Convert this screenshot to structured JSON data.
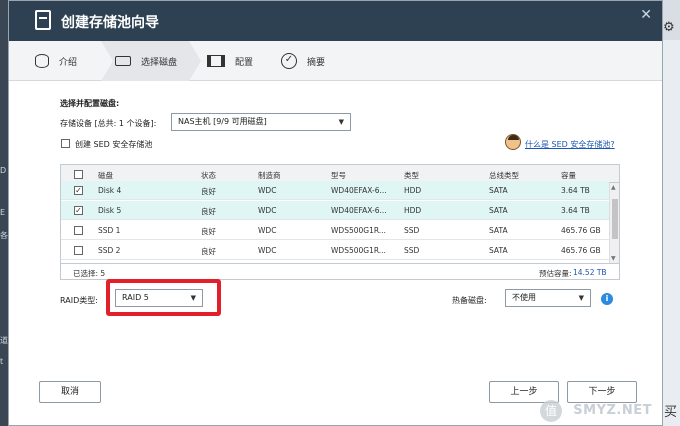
{
  "background": {
    "left_chars": [
      "D",
      "E",
      "各",
      "道",
      "t"
    ],
    "right_char": "买"
  },
  "window": {
    "title": "创建存储池向导",
    "close_glyph": "✕"
  },
  "steps": [
    {
      "label": "介绍",
      "icon": "database-icon"
    },
    {
      "label": "选择磁盘",
      "icon": "disk-icon"
    },
    {
      "label": "配置",
      "icon": "config-icon"
    },
    {
      "label": "摘要",
      "icon": "check-circle-icon"
    }
  ],
  "form": {
    "section_title": "选择并配置磁盘:",
    "storage_device_label": "存储设备 [总共: 1 个设备]:",
    "storage_device_value": "NAS主机 [9/9 可用磁盘]",
    "sed_checkbox_label": "创建 SED 安全存储池",
    "sed_link": "什么是 SED 安全存储池?"
  },
  "table": {
    "headers": [
      "磁盘",
      "状态",
      "制造商",
      "型号",
      "类型",
      "总线类型",
      "容量"
    ],
    "rows": [
      {
        "checked": true,
        "disk": "Disk 4",
        "status": "良好",
        "vendor": "WDC",
        "model": "WD40EFAX-6...",
        "type": "HDD",
        "bus": "SATA",
        "capacity": "3.64 TB"
      },
      {
        "checked": true,
        "disk": "Disk 5",
        "status": "良好",
        "vendor": "WDC",
        "model": "WD40EFAX-6...",
        "type": "HDD",
        "bus": "SATA",
        "capacity": "3.64 TB"
      },
      {
        "checked": false,
        "disk": "SSD 1",
        "status": "良好",
        "vendor": "WDC",
        "model": "WDS500G1R...",
        "type": "SSD",
        "bus": "SATA",
        "capacity": "465.76 GB"
      },
      {
        "checked": false,
        "disk": "SSD 2",
        "status": "良好",
        "vendor": "WDC",
        "model": "WDS500G1R...",
        "type": "SSD",
        "bus": "SATA",
        "capacity": "465.76 GB"
      }
    ],
    "selected_count_label": "已选择: 5",
    "estimated_capacity_label": "预估容量:",
    "estimated_capacity_value": "14.52 TB"
  },
  "raid": {
    "label": "RAID类型:",
    "value": "RAID 5",
    "hot_spare_label": "热备磁盘:",
    "hot_spare_value": "不使用"
  },
  "buttons": {
    "cancel": "取消",
    "back": "上一步",
    "next": "下一步"
  },
  "watermark": {
    "badge": "值",
    "text": "SMYZ.NET"
  },
  "colors": {
    "titlebar": "#2d4152",
    "selected_row": "#dff6f5",
    "highlight_box": "#e2202c",
    "link": "#1a57b0",
    "estimated_capacity": "#1a57b0"
  }
}
